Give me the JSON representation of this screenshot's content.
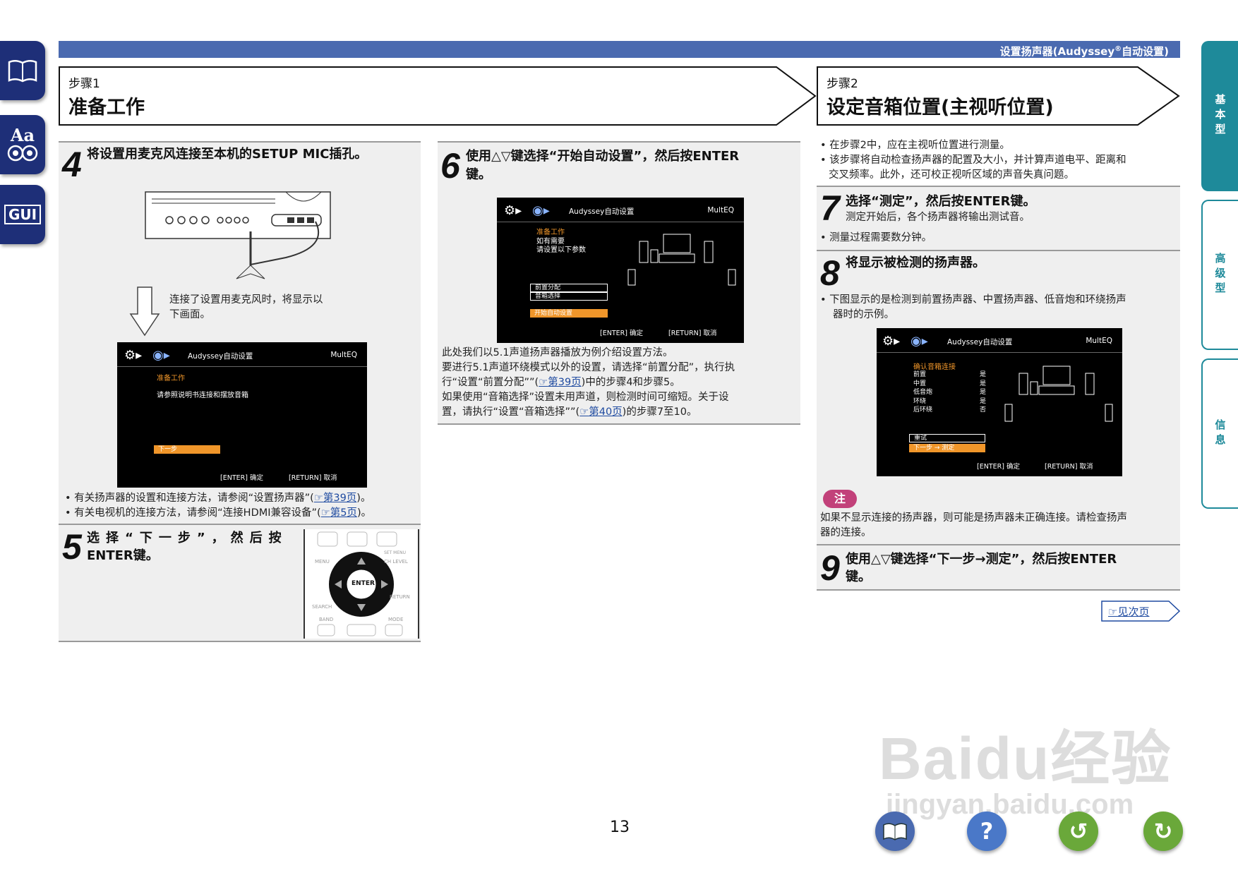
{
  "header": {
    "title_pre": "设置扬声器(Audyssey",
    "title_reg": "®",
    "title_post": "自动设置)"
  },
  "left_tabs": [
    {
      "icon": "book-icon"
    },
    {
      "icon": "text-font-icon",
      "text": "Aa"
    },
    {
      "icon": "gui-icon",
      "text": "GUI"
    }
  ],
  "right_tabs": [
    {
      "label": "基本型",
      "active": true
    },
    {
      "label": "高级型",
      "active": false
    },
    {
      "label": "信息",
      "active": false
    }
  ],
  "step1": {
    "small": "步骤1",
    "big": "准备工作"
  },
  "step2": {
    "small": "步骤2",
    "big": "设定音箱位置(主视听位置)"
  },
  "s4": {
    "num": "4",
    "text": "将设置用麦克风连接至本机的SETUP MIC插孔。",
    "caption_l1": "连接了设置用麦克风时，将显示以",
    "caption_l2": "下画面。",
    "screen": {
      "title": "Audyssey自动设置",
      "multeq": "MultEQ",
      "line1": "准备工作",
      "line2": "请参照说明书连接和摆放音箱",
      "bar": "下一步",
      "footer_l": "[ENTER] 确定",
      "footer_r": "[RETURN] 取消"
    },
    "bullet1_pre": "• 有关扬声器的设置和连接方法，请参阅“设置扬声器”(",
    "bullet1_link": "第39页",
    "bullet1_post": ")。",
    "bullet2_pre": "• 有关电视机的连接方法，请参阅“连接HDMI兼容设备”(",
    "bullet2_link": "第5页",
    "bullet2_post": ")。"
  },
  "s5": {
    "num": "5",
    "line1": "选择“下一步”，然后按",
    "line2": "ENTER键。",
    "remote": {
      "enter": "ENTER",
      "menu": "MENU",
      "search": "SEARCH",
      "band": "BAND",
      "mode": "MODE",
      "return": "RETURN",
      "ch_level": "CH LEVEL",
      "set_menu": "SET MENU"
    }
  },
  "s6": {
    "num": "6",
    "line1": "使用△▽键选择“开始自动设置”，然后按ENTER",
    "line2": "键。",
    "screen": {
      "title": "Audyssey自动设置",
      "multeq": "MultEQ",
      "line1": "准备工作",
      "line2": "如有需要",
      "line3": "请设置以下参数",
      "box1": "前置分配",
      "box2": "音箱选择",
      "bar": "开始自动设置",
      "footer_l": "[ENTER] 确定",
      "footer_r": "[RETURN] 取消"
    },
    "p1": "此处我们以5.1声道扬声器播放为例介绍设置方法。",
    "p2": "要进行5.1声道环绕模式以外的设置，请选择“前置分配”，执行执",
    "p3_pre": "行“设置“前置分配””(",
    "p3_link": "第39页",
    "p3_post": ")中的步骤4和步骤5。",
    "p4": "如果使用“音箱选择”设置未用声道，则检测时间可缩短。关于设",
    "p5_pre": "置，请执行“设置“音箱选择””(",
    "p5_link": "第40页",
    "p5_post": ")的步骤7至10。"
  },
  "s2_bullets": {
    "b1": "• 在步骤2中，应在主视听位置进行测量。",
    "b2": "• 该步骤将自动检查扬声器的配置及大小，并计算声道电平、距离和",
    "b3": "交叉频率。此外，还可校正视听区域的声音失真问题。"
  },
  "s7": {
    "num": "7",
    "title": "选择“测定”，然后按ENTER键。",
    "sub": "测定开始后，各个扬声器将输出测试音。",
    "bullet": "• 测量过程需要数分钟。"
  },
  "s8": {
    "num": "8",
    "title": "将显示被检测的扬声器。",
    "b1": "• 下图显示的是检测到前置扬声器、中置扬声器、低音炮和环绕扬声",
    "b2": "器时的示例。",
    "screen": {
      "title": "Audyssey自动设置",
      "multeq": "MultEQ",
      "heading": "确认音箱连接",
      "rows": [
        {
          "name": "前置",
          "val": "是"
        },
        {
          "name": "中置",
          "val": "是"
        },
        {
          "name": "低音炮",
          "val": "是"
        },
        {
          "name": "环绕",
          "val": "是"
        },
        {
          "name": "后环绕",
          "val": "否"
        }
      ],
      "box1": "重试",
      "bar": "下一步 → 测定",
      "footer_l": "[ENTER] 确定",
      "footer_r": "[RETURN] 取消"
    }
  },
  "note": {
    "label": "注",
    "l1": "如果不显示连接的扬声器，则可能是扬声器未正确连接。请检查扬声",
    "l2": "器的连接。"
  },
  "s9": {
    "num": "9",
    "line1": "使用△▽键选择“下一步→测定”，然后按ENTER",
    "line2": "键。"
  },
  "next_page": "见次页",
  "page_number": "13",
  "watermark": {
    "l1": "Baidu经验",
    "l2": "jingyan.baidu.com"
  },
  "bottom_nav": [
    {
      "icon": "book-icon",
      "color": "#4a6ab0"
    },
    {
      "icon": "help-icon",
      "color": "#4a78c8",
      "text": "?"
    },
    {
      "icon": "back-icon",
      "color": "#6aa83a",
      "text": "↺"
    },
    {
      "icon": "forward-icon",
      "color": "#6aa83a",
      "text": "↻"
    }
  ]
}
